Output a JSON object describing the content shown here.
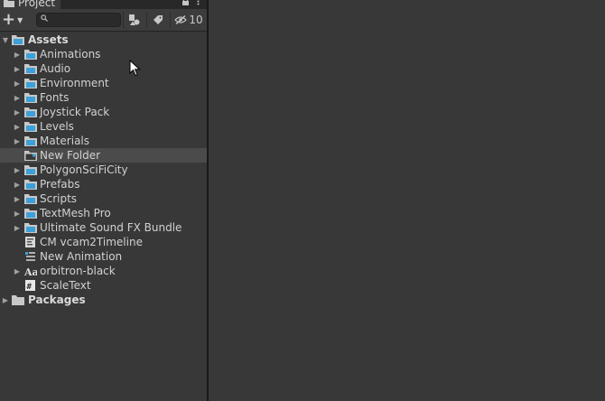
{
  "window": {
    "tab_title": "Project",
    "lock_icon": "lock-icon",
    "menu_icon": "kebab-menu-icon"
  },
  "toolbar": {
    "add_label": "+",
    "search_placeholder": "",
    "hidden_count": "10"
  },
  "colors": {
    "folder_blue": "#3ea0d8",
    "folder_grey": "#c8c8c8",
    "selected_row": "#4b4b4b",
    "background": "#383838"
  },
  "tree": {
    "assets_label": "Assets",
    "packages_label": "Packages",
    "items": [
      {
        "label": "Animations",
        "type": "folder",
        "expandable": true
      },
      {
        "label": "Audio",
        "type": "folder",
        "expandable": true
      },
      {
        "label": "Environment",
        "type": "folder",
        "expandable": true
      },
      {
        "label": "Fonts",
        "type": "folder",
        "expandable": true
      },
      {
        "label": "Joystick Pack",
        "type": "folder",
        "expandable": true
      },
      {
        "label": "Levels",
        "type": "folder",
        "expandable": true
      },
      {
        "label": "Materials",
        "type": "folder",
        "expandable": true
      },
      {
        "label": "New Folder",
        "type": "folder-empty",
        "expandable": false,
        "selected": true
      },
      {
        "label": "PolygonSciFiCity",
        "type": "folder",
        "expandable": true
      },
      {
        "label": "Prefabs",
        "type": "folder",
        "expandable": true
      },
      {
        "label": "Scripts",
        "type": "folder",
        "expandable": true
      },
      {
        "label": "TextMesh Pro",
        "type": "folder",
        "expandable": true
      },
      {
        "label": "Ultimate Sound FX Bundle",
        "type": "folder",
        "expandable": true
      },
      {
        "label": "CM vcam2Timeline",
        "type": "timeline",
        "expandable": false
      },
      {
        "label": "New Animation",
        "type": "animation",
        "expandable": false
      },
      {
        "label": "orbitron-black",
        "type": "font",
        "expandable": true
      },
      {
        "label": "ScaleText",
        "type": "script",
        "expandable": false
      }
    ]
  }
}
